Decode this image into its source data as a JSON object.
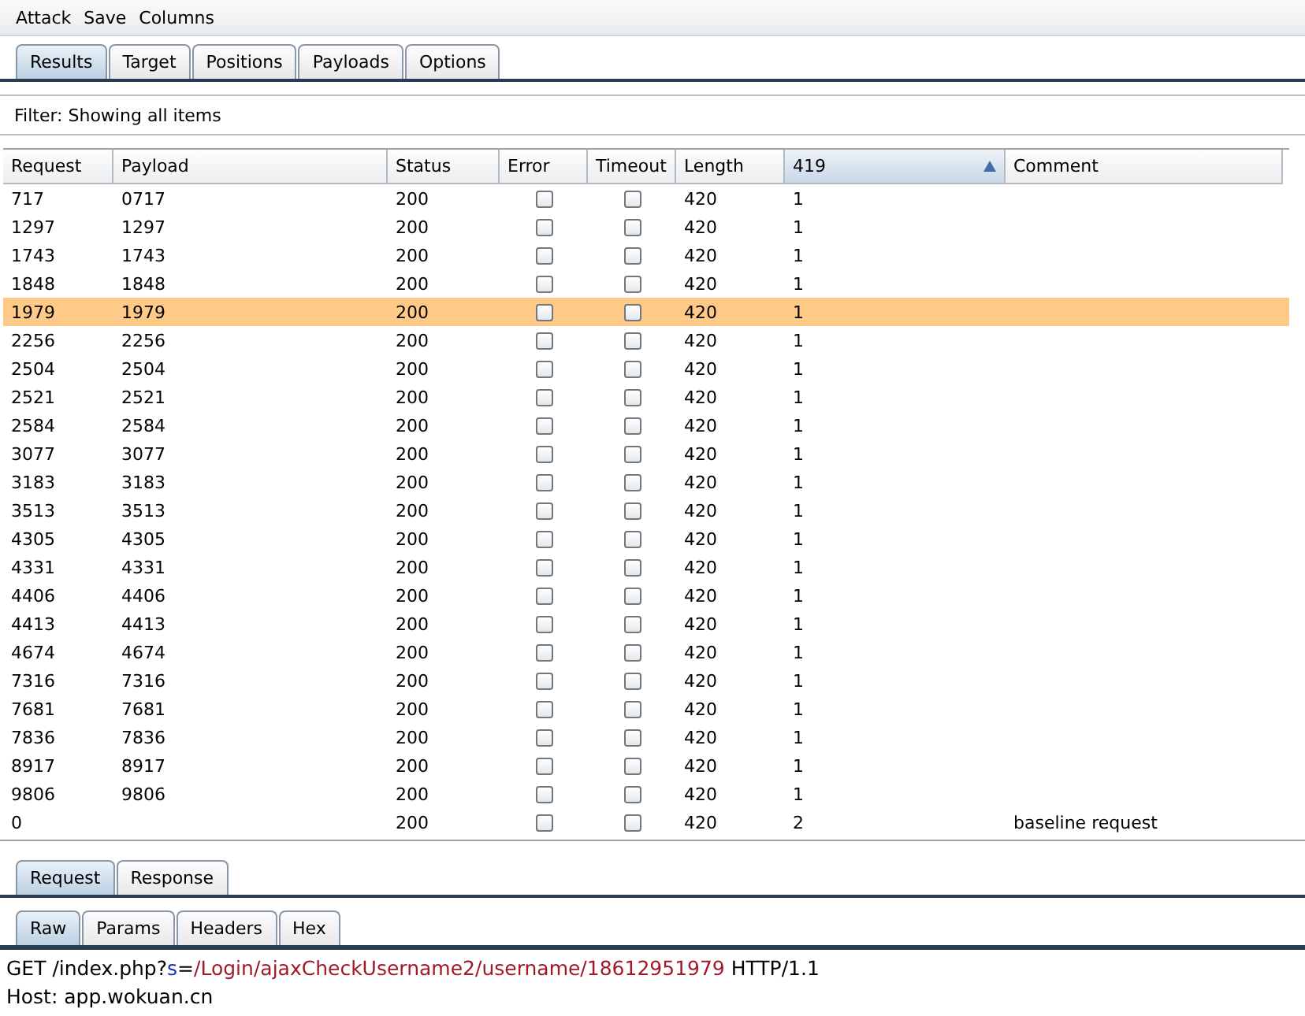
{
  "menu": [
    "Attack",
    "Save",
    "Columns"
  ],
  "tabs": [
    {
      "label": "Results",
      "selected": true
    },
    {
      "label": "Target",
      "selected": false
    },
    {
      "label": "Positions",
      "selected": false
    },
    {
      "label": "Payloads",
      "selected": false
    },
    {
      "label": "Options",
      "selected": false
    }
  ],
  "filter": "Filter:  Showing all items",
  "table": {
    "columns": [
      {
        "label": "Request",
        "sorted": false
      },
      {
        "label": "Payload",
        "sorted": false
      },
      {
        "label": "Status",
        "sorted": false
      },
      {
        "label": "Error",
        "sorted": false
      },
      {
        "label": "Timeout",
        "sorted": false
      },
      {
        "label": "Length",
        "sorted": false
      },
      {
        "label": "419",
        "sorted": true
      },
      {
        "label": "Comment",
        "sorted": false
      }
    ],
    "rows": [
      {
        "request": "717",
        "payload": "0717",
        "status": "200",
        "error": false,
        "timeout": false,
        "length": "420",
        "col_419": "1",
        "selected": false
      },
      {
        "request": "1297",
        "payload": "1297",
        "status": "200",
        "error": false,
        "timeout": false,
        "length": "420",
        "col_419": "1",
        "selected": false
      },
      {
        "request": "1743",
        "payload": "1743",
        "status": "200",
        "error": false,
        "timeout": false,
        "length": "420",
        "col_419": "1",
        "selected": false
      },
      {
        "request": "1848",
        "payload": "1848",
        "status": "200",
        "error": false,
        "timeout": false,
        "length": "420",
        "col_419": "1",
        "selected": false
      },
      {
        "request": "1979",
        "payload": "1979",
        "status": "200",
        "error": false,
        "timeout": false,
        "length": "420",
        "col_419": "1",
        "selected": true
      },
      {
        "request": "2256",
        "payload": "2256",
        "status": "200",
        "error": false,
        "timeout": false,
        "length": "420",
        "col_419": "1",
        "selected": false
      },
      {
        "request": "2504",
        "payload": "2504",
        "status": "200",
        "error": false,
        "timeout": false,
        "length": "420",
        "col_419": "1",
        "selected": false
      },
      {
        "request": "2521",
        "payload": "2521",
        "status": "200",
        "error": false,
        "timeout": false,
        "length": "420",
        "col_419": "1",
        "selected": false
      },
      {
        "request": "2584",
        "payload": "2584",
        "status": "200",
        "error": false,
        "timeout": false,
        "length": "420",
        "col_419": "1",
        "selected": false
      },
      {
        "request": "3077",
        "payload": "3077",
        "status": "200",
        "error": false,
        "timeout": false,
        "length": "420",
        "col_419": "1",
        "selected": false
      },
      {
        "request": "3183",
        "payload": "3183",
        "status": "200",
        "error": false,
        "timeout": false,
        "length": "420",
        "col_419": "1",
        "selected": false
      },
      {
        "request": "3513",
        "payload": "3513",
        "status": "200",
        "error": false,
        "timeout": false,
        "length": "420",
        "col_419": "1",
        "selected": false
      },
      {
        "request": "4305",
        "payload": "4305",
        "status": "200",
        "error": false,
        "timeout": false,
        "length": "420",
        "col_419": "1",
        "selected": false
      },
      {
        "request": "4331",
        "payload": "4331",
        "status": "200",
        "error": false,
        "timeout": false,
        "length": "420",
        "col_419": "1",
        "selected": false
      },
      {
        "request": "4406",
        "payload": "4406",
        "status": "200",
        "error": false,
        "timeout": false,
        "length": "420",
        "col_419": "1",
        "selected": false
      },
      {
        "request": "4413",
        "payload": "4413",
        "status": "200",
        "error": false,
        "timeout": false,
        "length": "420",
        "col_419": "1",
        "selected": false
      },
      {
        "request": "4674",
        "payload": "4674",
        "status": "200",
        "error": false,
        "timeout": false,
        "length": "420",
        "col_419": "1",
        "selected": false
      },
      {
        "request": "7316",
        "payload": "7316",
        "status": "200",
        "error": false,
        "timeout": false,
        "length": "420",
        "col_419": "1",
        "selected": false
      },
      {
        "request": "7681",
        "payload": "7681",
        "status": "200",
        "error": false,
        "timeout": false,
        "length": "420",
        "col_419": "1",
        "selected": false
      },
      {
        "request": "7836",
        "payload": "7836",
        "status": "200",
        "error": false,
        "timeout": false,
        "length": "420",
        "col_419": "1",
        "selected": false
      },
      {
        "request": "8917",
        "payload": "8917",
        "status": "200",
        "error": false,
        "timeout": false,
        "length": "420",
        "col_419": "1",
        "selected": false
      },
      {
        "request": "9806",
        "payload": "9806",
        "status": "200",
        "error": false,
        "timeout": false,
        "length": "420",
        "col_419": "1",
        "selected": false
      },
      {
        "request": "0",
        "status": "200",
        "error": false,
        "timeout": false,
        "length": "420",
        "col_419": "2",
        "comment": "baseline request",
        "selected": false
      }
    ]
  },
  "message_tabs": [
    {
      "label": "Request",
      "selected": true
    },
    {
      "label": "Response",
      "selected": false
    }
  ],
  "view_tabs": [
    {
      "label": "Raw",
      "selected": true
    },
    {
      "label": "Params",
      "selected": false
    },
    {
      "label": "Headers",
      "selected": false
    },
    {
      "label": "Hex",
      "selected": false
    }
  ],
  "request_lines": [
    [
      {
        "kind": "plain",
        "text": "GET /index.php?"
      },
      {
        "kind": "name",
        "text": "s"
      },
      {
        "kind": "plain",
        "text": "="
      },
      {
        "kind": "value",
        "text": "/Login/ajaxCheckUsername2/username/18612951979"
      },
      {
        "kind": "plain",
        "text": " HTTP/1.1"
      }
    ],
    [
      {
        "kind": "plain",
        "text": "Host: app.wokuan.cn"
      }
    ]
  ]
}
